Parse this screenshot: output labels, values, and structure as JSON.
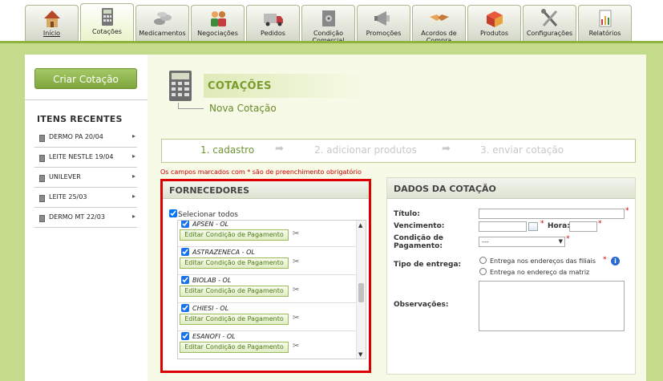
{
  "nav": {
    "tabs": [
      {
        "label": "Início",
        "icon": "house-icon"
      },
      {
        "label": "Cotações",
        "icon": "calculator-icon"
      },
      {
        "label": "Medicamentos",
        "icon": "pills-icon"
      },
      {
        "label": "Negociações",
        "icon": "people-icon"
      },
      {
        "label": "Pedidos",
        "icon": "truck-icon"
      },
      {
        "label": "Condição Comercial",
        "icon": "safe-icon"
      },
      {
        "label": "Promoções",
        "icon": "megaphone-icon"
      },
      {
        "label": "Acordos de Compra",
        "icon": "handshake-icon"
      },
      {
        "label": "Produtos",
        "icon": "box-icon"
      },
      {
        "label": "Configurações",
        "icon": "tools-icon"
      },
      {
        "label": "Relatórios",
        "icon": "chart-icon"
      }
    ],
    "active_index": 1
  },
  "sidebar": {
    "create_button": "Criar Cotação",
    "recent_title": "ITENS RECENTES",
    "recent_items": [
      "DERMO PA 20/04",
      "LEITE NESTLE 19/04",
      "UNILEVER",
      "LEITE 25/03",
      "DERMO MT 22/03"
    ]
  },
  "main": {
    "title": "COTAÇÕES",
    "subtitle": "Nova Cotação",
    "steps": [
      "1. cadastro",
      "2. adicionar produtos",
      "3. enviar cotação"
    ],
    "required_note": "Os campos marcados com * são de preenchimento obrigatório"
  },
  "fornecedores": {
    "heading": "FORNECEDORES",
    "select_all": "Selecionar todos",
    "edit_label": "Editar Condição de Pagamento",
    "items": [
      "APSEN - OL",
      "ASTRAZENECA - OL",
      "BIOLAB - OL",
      "CHIESI - OL",
      "ESANOFI - OL"
    ]
  },
  "dados": {
    "heading": "DADOS DA COTAÇÃO",
    "titulo_label": "Título:",
    "vencimento_label": "Vencimento:",
    "hora_label": "Hora:",
    "condicao_label": "Condição de Pagamento:",
    "condicao_value": "---",
    "tipo_entrega_label": "Tipo de entrega:",
    "entrega_option_1": "Entrega nos endereços das filiais",
    "entrega_option_2": "Entrega no endereço da matriz",
    "observacoes_label": "Observações:",
    "required_mark": "*"
  }
}
